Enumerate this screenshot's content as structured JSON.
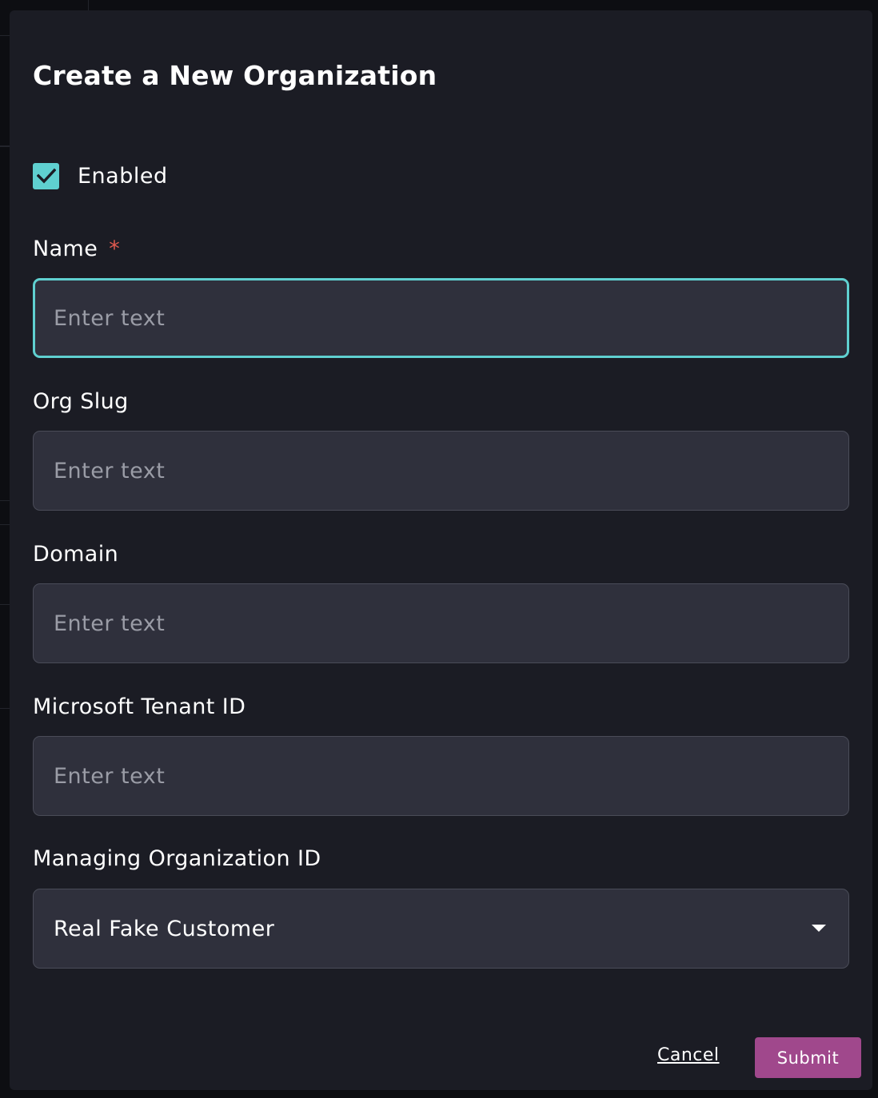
{
  "dialog": {
    "title": "Create a New Organization",
    "enabled": {
      "label": "Enabled",
      "checked": true
    },
    "fields": {
      "name": {
        "label": "Name",
        "required_marker": "*",
        "placeholder": "Enter text",
        "value": ""
      },
      "org_slug": {
        "label": "Org Slug",
        "placeholder": "Enter text",
        "value": ""
      },
      "domain": {
        "label": "Domain",
        "placeholder": "Enter text",
        "value": ""
      },
      "microsoft_tenant_id": {
        "label": "Microsoft Tenant ID",
        "placeholder": "Enter text",
        "value": ""
      },
      "managing_organization_id": {
        "label": "Managing Organization ID",
        "selected": "Real Fake Customer"
      }
    },
    "actions": {
      "cancel_label": "Cancel",
      "submit_label": "Submit"
    }
  },
  "icons": {
    "checkbox": "checkmark-icon",
    "select": "caret-down-icon"
  },
  "colors": {
    "accent": "#5fd0d0",
    "submit": "#a0488c",
    "required": "#e0594f",
    "modal_bg": "#1b1c24",
    "input_bg": "#2f303c"
  }
}
